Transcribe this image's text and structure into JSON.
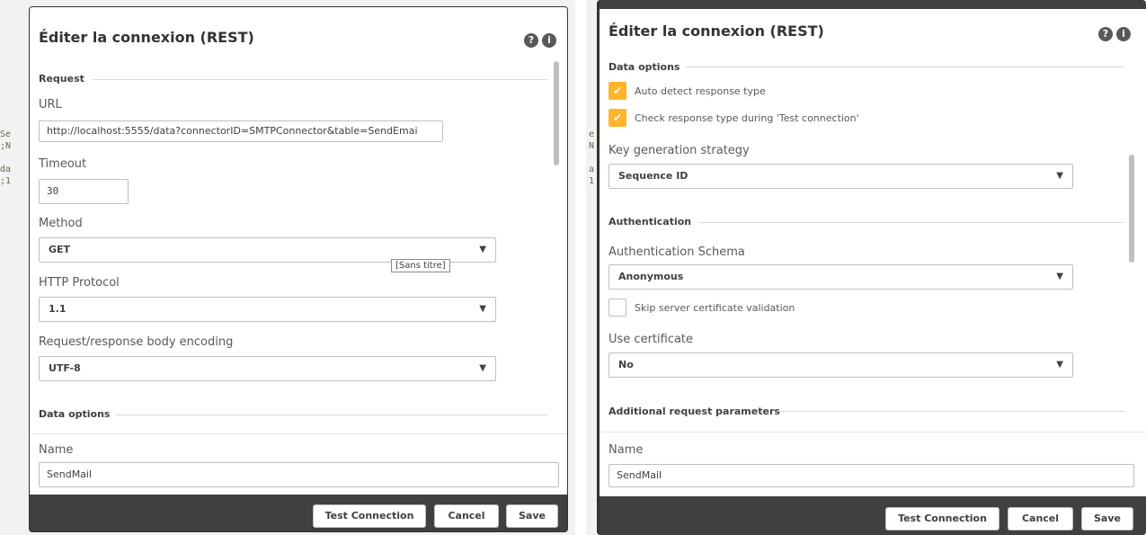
{
  "left_dialog": {
    "title": "Éditer la connexion (REST)",
    "section_request": "Request",
    "url_label": "URL",
    "url_value": "http://localhost:5555/data?connectorID=SMTPConnector&table=SendEmai",
    "timeout_label": "Timeout",
    "timeout_value": "30",
    "method_label": "Method",
    "method_value": "GET",
    "tooltip": "[Sans titre]",
    "http_label": "HTTP Protocol",
    "http_value": "1.1",
    "encoding_label": "Request/response body encoding",
    "encoding_value": "UTF-8",
    "section_data": "Data options",
    "name_label": "Name",
    "name_value": "SendMail",
    "btn_test": "Test Connection",
    "btn_cancel": "Cancel",
    "btn_save": "Save"
  },
  "right_dialog": {
    "title": "Éditer la connexion (REST)",
    "section_data": "Data options",
    "cb_auto": "Auto detect response type",
    "cb_check": "Check response type during 'Test connection'",
    "keygen_label": "Key generation strategy",
    "keygen_value": "Sequence ID",
    "section_auth": "Authentication",
    "schema_label": "Authentication Schema",
    "schema_value": "Anonymous",
    "cb_skip": "Skip server certificate validation",
    "cert_label": "Use certificate",
    "cert_value": "No",
    "section_additional": "Additional request parameters",
    "name_label": "Name",
    "name_value": "SendMail",
    "btn_test": "Test Connection",
    "btn_cancel": "Cancel",
    "btn_save": "Save"
  },
  "icons": {
    "help": "help-icon",
    "info": "info-icon",
    "check": "check-icon",
    "dropdown": "chevron-down-icon"
  },
  "colors": {
    "accent": "#ffb42a",
    "frame": "#404040",
    "footer": "#404040"
  }
}
